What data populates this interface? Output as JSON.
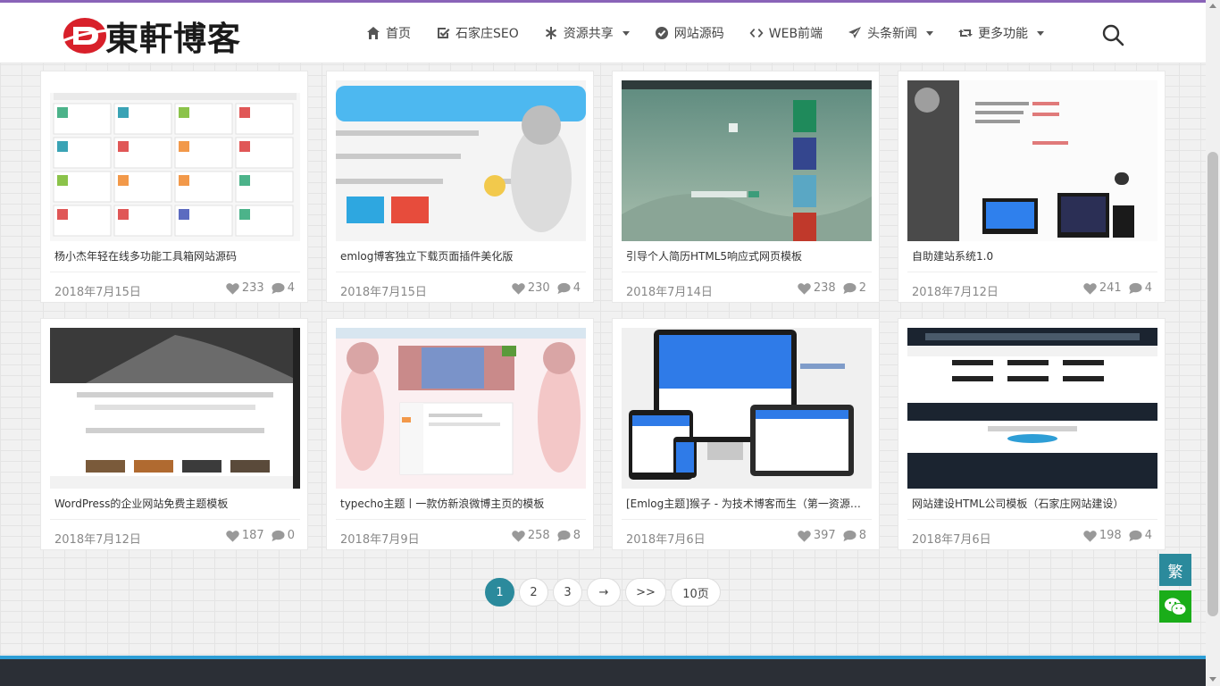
{
  "site": {
    "logo_text": "東軒博客",
    "brand_color": "#d8202a",
    "accent_color": "#2b8a9c"
  },
  "nav": [
    {
      "label": "首页",
      "icon": "home-icon",
      "dropdown": false
    },
    {
      "label": "石家庄SEO",
      "icon": "checkbox-icon",
      "dropdown": false
    },
    {
      "label": "资源共享",
      "icon": "asterisk-icon",
      "dropdown": true
    },
    {
      "label": "网站源码",
      "icon": "check-circle-icon",
      "dropdown": false
    },
    {
      "label": "WEB前端",
      "icon": "code-icon",
      "dropdown": false
    },
    {
      "label": "头条新闻",
      "icon": "paper-plane-icon",
      "dropdown": true
    },
    {
      "label": "更多功能",
      "icon": "retweet-icon",
      "dropdown": true
    }
  ],
  "search": {
    "icon": "search-icon"
  },
  "posts": [
    {
      "title": "杨小杰年轻在线多功能工具箱网站源码",
      "date": "2018年7月15日",
      "likes": "233",
      "comments": "4"
    },
    {
      "title": "emlog博客独立下载页面插件美化版",
      "date": "2018年7月15日",
      "likes": "230",
      "comments": "4"
    },
    {
      "title": "引导个人简历HTML5响应式网页模板",
      "date": "2018年7月14日",
      "likes": "238",
      "comments": "2"
    },
    {
      "title": "自助建站系统1.0",
      "date": "2018年7月12日",
      "likes": "241",
      "comments": "4"
    },
    {
      "title": "WordPress的企业网站免费主题模板",
      "date": "2018年7月12日",
      "likes": "187",
      "comments": "0"
    },
    {
      "title": "typecho主题丨一款仿新浪微博主页的模板",
      "date": "2018年7月9日",
      "likes": "258",
      "comments": "8"
    },
    {
      "title": "[Emlog主题]猴子 - 为技术博客而生（第一资源网）",
      "date": "2018年7月6日",
      "likes": "397",
      "comments": "8"
    },
    {
      "title": "网站建设HTML公司模板（石家庄网站建设）",
      "date": "2018年7月6日",
      "likes": "198",
      "comments": "4"
    }
  ],
  "pagination": {
    "pages": [
      "1",
      "2",
      "3",
      "→",
      ">>",
      "10页"
    ],
    "active": "1"
  },
  "side": {
    "traditional_label": "繁",
    "wechat_icon": "wechat-icon"
  }
}
